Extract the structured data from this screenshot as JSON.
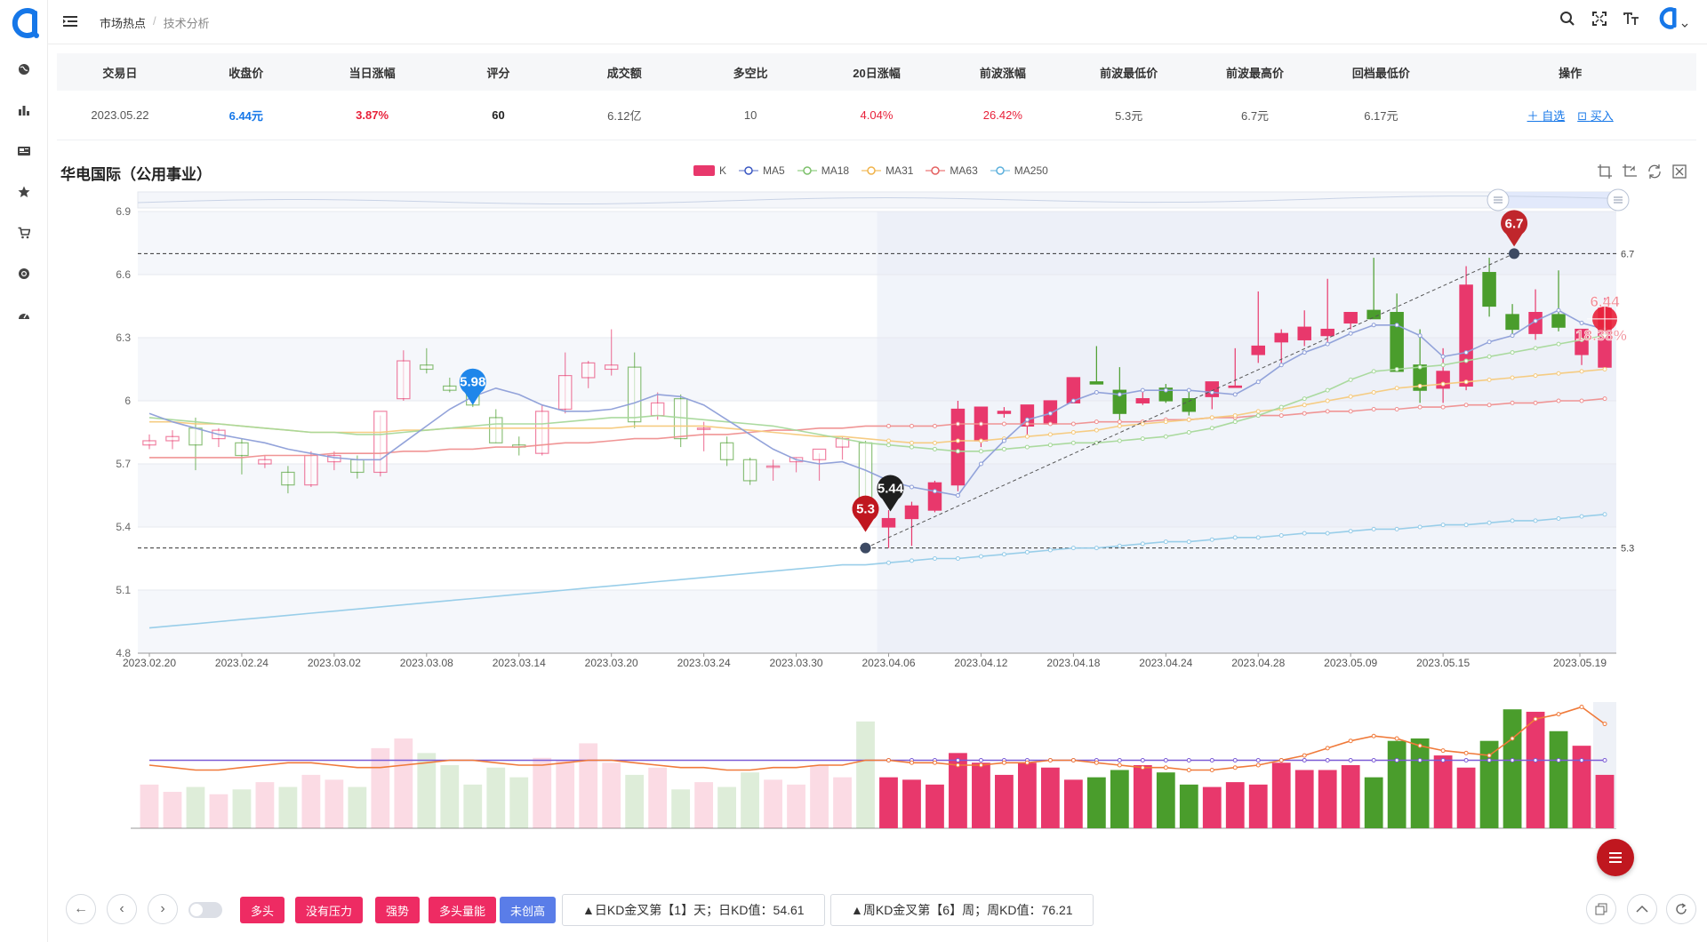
{
  "breadcrumb": {
    "root": "市场热点",
    "separator": "/",
    "current": "技术分析"
  },
  "summary": {
    "headers": [
      "交易日",
      "收盘价",
      "当日涨幅",
      "评分",
      "成交额",
      "多空比",
      "20日涨幅",
      "前波涨幅",
      "前波最低价",
      "前波最高价",
      "回档最低价",
      "操作"
    ],
    "row": {
      "date": "2023.05.22",
      "close": "6.44元",
      "change": "3.87%",
      "score": "60",
      "turnover": "6.12亿",
      "ratio": "10",
      "change20": "4.04%",
      "wave_change": "26.42%",
      "wave_low": "5.3元",
      "wave_high": "6.7元",
      "pullback_low": "6.17元",
      "op_watch": "自选",
      "op_buy": "买入"
    }
  },
  "chart_title": "华电国际（公用事业）",
  "legend": [
    "K",
    "MA5",
    "MA18",
    "MA31",
    "MA63",
    "MA250"
  ],
  "colors": {
    "up": "#e8386c",
    "down": "#4a9d2c",
    "ma5": "#8d9ed8",
    "ma18": "#a6d89a",
    "ma31": "#f5c97c",
    "ma63": "#ef8f8f",
    "ma250": "#94cbe8",
    "accent": "#1677e8"
  },
  "chart_data": {
    "type": "candlestick",
    "ylim": [
      4.8,
      6.9
    ],
    "yticks": [
      "6.9",
      "6.6",
      "6.3",
      "6",
      "5.7",
      "5.4",
      "5.1",
      "4.8"
    ],
    "xticks": [
      "2023.02.20",
      "2023.02.24",
      "2023.03.02",
      "2023.03.08",
      "2023.03.14",
      "2023.03.20",
      "2023.03.24",
      "2023.03.30",
      "2023.04.06",
      "2023.04.12",
      "2023.04.18",
      "2023.04.24",
      "2023.04.28",
      "2023.05.09",
      "2023.05.15",
      "2023.05.19"
    ],
    "candles": [
      {
        "o": 5.79,
        "h": 5.84,
        "l": 5.77,
        "c": 5.81
      },
      {
        "o": 5.81,
        "h": 5.86,
        "l": 5.77,
        "c": 5.83
      },
      {
        "o": 5.87,
        "h": 5.92,
        "l": 5.67,
        "c": 5.79
      },
      {
        "o": 5.82,
        "h": 5.87,
        "l": 5.78,
        "c": 5.86
      },
      {
        "o": 5.8,
        "h": 5.82,
        "l": 5.65,
        "c": 5.74
      },
      {
        "o": 5.7,
        "h": 5.74,
        "l": 5.68,
        "c": 5.72
      },
      {
        "o": 5.66,
        "h": 5.69,
        "l": 5.56,
        "c": 5.6
      },
      {
        "o": 5.6,
        "h": 5.76,
        "l": 5.59,
        "c": 5.74
      },
      {
        "o": 5.71,
        "h": 5.76,
        "l": 5.67,
        "c": 5.74
      },
      {
        "o": 5.72,
        "h": 5.74,
        "l": 5.63,
        "c": 5.66
      },
      {
        "o": 5.66,
        "h": 5.93,
        "l": 5.64,
        "c": 5.95
      },
      {
        "o": 6.01,
        "h": 6.24,
        "l": 6.0,
        "c": 6.19
      },
      {
        "o": 6.17,
        "h": 6.25,
        "l": 6.13,
        "c": 6.15
      },
      {
        "o": 6.07,
        "h": 6.11,
        "l": 6.04,
        "c": 6.05
      },
      {
        "o": 6.05,
        "h": 6.09,
        "l": 5.97,
        "c": 5.98
      },
      {
        "o": 5.92,
        "h": 5.96,
        "l": 5.8,
        "c": 5.8
      },
      {
        "o": 5.79,
        "h": 5.83,
        "l": 5.74,
        "c": 5.78
      },
      {
        "o": 5.75,
        "h": 5.98,
        "l": 5.74,
        "c": 5.95
      },
      {
        "o": 5.96,
        "h": 6.23,
        "l": 5.94,
        "c": 6.12
      },
      {
        "o": 6.11,
        "h": 6.19,
        "l": 6.06,
        "c": 6.18
      },
      {
        "o": 6.15,
        "h": 6.34,
        "l": 6.12,
        "c": 6.17
      },
      {
        "o": 6.16,
        "h": 6.23,
        "l": 5.87,
        "c": 5.9
      },
      {
        "o": 5.93,
        "h": 6.04,
        "l": 5.91,
        "c": 5.99
      },
      {
        "o": 6.01,
        "h": 6.03,
        "l": 5.78,
        "c": 5.82
      },
      {
        "o": 5.87,
        "h": 5.9,
        "l": 5.76,
        "c": 5.87
      },
      {
        "o": 5.8,
        "h": 5.83,
        "l": 5.69,
        "c": 5.72
      },
      {
        "o": 5.72,
        "h": 5.73,
        "l": 5.6,
        "c": 5.62
      },
      {
        "o": 5.69,
        "h": 5.72,
        "l": 5.62,
        "c": 5.69
      },
      {
        "o": 5.71,
        "h": 5.73,
        "l": 5.66,
        "c": 5.73
      },
      {
        "o": 5.72,
        "h": 5.75,
        "l": 5.62,
        "c": 5.77
      },
      {
        "o": 5.78,
        "h": 5.83,
        "l": 5.72,
        "c": 5.82
      },
      {
        "o": 5.8,
        "h": 5.81,
        "l": 5.42,
        "c": 5.44
      },
      {
        "o": 5.4,
        "h": 5.48,
        "l": 5.3,
        "c": 5.44
      },
      {
        "o": 5.44,
        "h": 5.52,
        "l": 5.31,
        "c": 5.5
      },
      {
        "o": 5.48,
        "h": 5.62,
        "l": 5.47,
        "c": 5.61
      },
      {
        "o": 5.6,
        "h": 6.0,
        "l": 5.57,
        "c": 5.96
      },
      {
        "o": 5.81,
        "h": 5.97,
        "l": 5.78,
        "c": 5.97
      },
      {
        "o": 5.94,
        "h": 5.97,
        "l": 5.92,
        "c": 5.95
      },
      {
        "o": 5.88,
        "h": 5.98,
        "l": 5.84,
        "c": 5.98
      },
      {
        "o": 5.89,
        "h": 6.0,
        "l": 5.89,
        "c": 6.0
      },
      {
        "o": 5.99,
        "h": 6.11,
        "l": 5.99,
        "c": 6.11
      },
      {
        "o": 6.09,
        "h": 6.26,
        "l": 6.08,
        "c": 6.08
      },
      {
        "o": 6.05,
        "h": 6.16,
        "l": 5.9,
        "c": 5.94
      },
      {
        "o": 5.99,
        "h": 6.04,
        "l": 5.98,
        "c": 6.01
      },
      {
        "o": 6.06,
        "h": 6.08,
        "l": 5.99,
        "c": 6.0
      },
      {
        "o": 6.01,
        "h": 6.05,
        "l": 5.93,
        "c": 5.95
      },
      {
        "o": 6.02,
        "h": 6.08,
        "l": 5.96,
        "c": 6.09
      },
      {
        "o": 6.07,
        "h": 6.25,
        "l": 6.07,
        "c": 6.07
      },
      {
        "o": 6.22,
        "h": 6.52,
        "l": 6.18,
        "c": 6.26
      },
      {
        "o": 6.28,
        "h": 6.34,
        "l": 6.17,
        "c": 6.32
      },
      {
        "o": 6.29,
        "h": 6.43,
        "l": 6.26,
        "c": 6.35
      },
      {
        "o": 6.31,
        "h": 6.58,
        "l": 6.28,
        "c": 6.34
      },
      {
        "o": 6.37,
        "h": 6.41,
        "l": 6.34,
        "c": 6.42
      },
      {
        "o": 6.43,
        "h": 6.68,
        "l": 6.41,
        "c": 6.39
      },
      {
        "o": 6.42,
        "h": 6.51,
        "l": 6.18,
        "c": 6.14
      },
      {
        "o": 6.17,
        "h": 6.34,
        "l": 5.99,
        "c": 6.05
      },
      {
        "o": 6.06,
        "h": 6.25,
        "l": 5.99,
        "c": 6.14
      },
      {
        "o": 6.07,
        "h": 6.64,
        "l": 6.05,
        "c": 6.55
      },
      {
        "o": 6.61,
        "h": 6.68,
        "l": 6.4,
        "c": 6.45
      },
      {
        "o": 6.41,
        "h": 6.46,
        "l": 6.3,
        "c": 6.34
      },
      {
        "o": 6.32,
        "h": 6.53,
        "l": 6.29,
        "c": 6.42
      },
      {
        "o": 6.41,
        "h": 6.62,
        "l": 6.33,
        "c": 6.35
      },
      {
        "o": 6.22,
        "h": 6.33,
        "l": 6.17,
        "c": 6.34
      },
      {
        "o": 6.16,
        "h": 6.49,
        "l": 6.15,
        "c": 6.44
      }
    ],
    "ma5": [
      5.94,
      5.9,
      5.87,
      5.84,
      5.82,
      5.8,
      5.77,
      5.75,
      5.73,
      5.72,
      5.72,
      5.8,
      5.88,
      5.96,
      6.02,
      6.06,
      6.03,
      5.98,
      5.95,
      5.95,
      5.96,
      5.99,
      6.03,
      6.02,
      5.98,
      5.91,
      5.84,
      5.77,
      5.72,
      5.7,
      5.71,
      5.67,
      5.62,
      5.59,
      5.57,
      5.55,
      5.7,
      5.81,
      5.91,
      5.94,
      6.0,
      6.04,
      6.03,
      6.05,
      6.05,
      6.05,
      6.04,
      6.03,
      6.09,
      6.17,
      6.23,
      6.27,
      6.32,
      6.36,
      6.36,
      6.31,
      6.21,
      6.23,
      6.28,
      6.31,
      6.38,
      6.43,
      6.37,
      6.34
    ],
    "ma18": [
      5.92,
      5.91,
      5.9,
      5.89,
      5.88,
      5.87,
      5.86,
      5.85,
      5.85,
      5.84,
      5.84,
      5.85,
      5.86,
      5.87,
      5.88,
      5.89,
      5.89,
      5.89,
      5.9,
      5.91,
      5.92,
      5.92,
      5.93,
      5.92,
      5.91,
      5.9,
      5.89,
      5.88,
      5.86,
      5.84,
      5.82,
      5.8,
      5.79,
      5.78,
      5.77,
      5.76,
      5.76,
      5.77,
      5.78,
      5.79,
      5.8,
      5.8,
      5.81,
      5.82,
      5.83,
      5.85,
      5.87,
      5.9,
      5.93,
      5.97,
      6.01,
      6.05,
      6.1,
      6.14,
      6.15,
      6.16,
      6.17,
      6.19,
      6.21,
      6.23,
      6.25,
      6.27,
      6.29,
      6.31
    ],
    "ma31": [
      5.9,
      5.9,
      5.89,
      5.89,
      5.88,
      5.87,
      5.86,
      5.85,
      5.85,
      5.85,
      5.85,
      5.86,
      5.86,
      5.87,
      5.87,
      5.87,
      5.87,
      5.87,
      5.87,
      5.87,
      5.87,
      5.88,
      5.88,
      5.88,
      5.88,
      5.87,
      5.86,
      5.85,
      5.84,
      5.83,
      5.83,
      5.82,
      5.81,
      5.8,
      5.8,
      5.81,
      5.81,
      5.82,
      5.83,
      5.84,
      5.85,
      5.86,
      5.88,
      5.89,
      5.9,
      5.91,
      5.92,
      5.93,
      5.95,
      5.96,
      5.98,
      6.0,
      6.02,
      6.04,
      6.06,
      6.07,
      6.08,
      6.09,
      6.1,
      6.11,
      6.12,
      6.13,
      6.14,
      6.15
    ],
    "ma63": [
      5.73,
      5.73,
      5.73,
      5.73,
      5.73,
      5.74,
      5.74,
      5.74,
      5.75,
      5.75,
      5.75,
      5.76,
      5.76,
      5.77,
      5.77,
      5.78,
      5.78,
      5.79,
      5.8,
      5.8,
      5.81,
      5.82,
      5.82,
      5.83,
      5.84,
      5.84,
      5.85,
      5.86,
      5.86,
      5.87,
      5.87,
      5.88,
      5.88,
      5.88,
      5.88,
      5.89,
      5.89,
      5.89,
      5.89,
      5.89,
      5.89,
      5.9,
      5.9,
      5.9,
      5.91,
      5.91,
      5.92,
      5.92,
      5.93,
      5.93,
      5.94,
      5.95,
      5.95,
      5.96,
      5.96,
      5.97,
      5.97,
      5.98,
      5.98,
      5.99,
      5.99,
      6.0,
      6.0,
      6.01
    ],
    "ma250": [
      4.92,
      4.93,
      4.94,
      4.95,
      4.96,
      4.97,
      4.98,
      4.99,
      5.0,
      5.01,
      5.02,
      5.03,
      5.04,
      5.05,
      5.06,
      5.07,
      5.08,
      5.09,
      5.1,
      5.11,
      5.12,
      5.13,
      5.14,
      5.15,
      5.16,
      5.17,
      5.18,
      5.19,
      5.2,
      5.21,
      5.22,
      5.22,
      5.23,
      5.24,
      5.25,
      5.25,
      5.26,
      5.27,
      5.28,
      5.29,
      5.3,
      5.3,
      5.31,
      5.32,
      5.33,
      5.33,
      5.34,
      5.35,
      5.35,
      5.36,
      5.37,
      5.37,
      5.38,
      5.39,
      5.39,
      5.4,
      5.41,
      5.41,
      5.42,
      5.43,
      5.43,
      5.44,
      5.45,
      5.46
    ],
    "volume": [
      18,
      15,
      17,
      14,
      16,
      19,
      17,
      22,
      20,
      17,
      33,
      37,
      31,
      26,
      18,
      25,
      21,
      29,
      28,
      35,
      27,
      22,
      25,
      16,
      19,
      17,
      23,
      20,
      18,
      26,
      21,
      44,
      21,
      20,
      18,
      31,
      27,
      22,
      27,
      25,
      20,
      21,
      24,
      26,
      23,
      18,
      17,
      19,
      18,
      27,
      24,
      24,
      26,
      21,
      36,
      37,
      30,
      25,
      36,
      49,
      48,
      40,
      34,
      22,
      29
    ],
    "vol_line_a": [
      26,
      25,
      24,
      24,
      25,
      26,
      27,
      27,
      26,
      25,
      25,
      26,
      27,
      28,
      28,
      27,
      26,
      26,
      27,
      28,
      28,
      27,
      26,
      25,
      25,
      24,
      24,
      25,
      25,
      26,
      26,
      28,
      28,
      27,
      27,
      26,
      26,
      27,
      27,
      28,
      28,
      27,
      26,
      25,
      25,
      24,
      24,
      25,
      26,
      28,
      30,
      33,
      36,
      38,
      37,
      34,
      32,
      31,
      30,
      37,
      45,
      47,
      50,
      43,
      37
    ],
    "vol_line_b": [
      28,
      28,
      28,
      28,
      28,
      28,
      28,
      28,
      28,
      28,
      28,
      28,
      28,
      28,
      28,
      28,
      28,
      28,
      28,
      28,
      28,
      28,
      28,
      28,
      28,
      28,
      28,
      28,
      28,
      28,
      28,
      28,
      28,
      28,
      28,
      28,
      28,
      28,
      28,
      28,
      28,
      28,
      28,
      28,
      28,
      28,
      28,
      28,
      28,
      28,
      28,
      28,
      28,
      28,
      28,
      28,
      28,
      28,
      28,
      28,
      28,
      28,
      28,
      28,
      28
    ],
    "markers": {
      "high": {
        "label": "6.7",
        "value": 6.7
      },
      "low": {
        "label": "5.3",
        "value": 5.3
      },
      "blue": {
        "label": "5.98"
      },
      "black": {
        "label": "5.44"
      },
      "current": {
        "label": "6.44",
        "pct": "18.38%"
      }
    },
    "ref_lines": [
      "6.7",
      "5.3"
    ]
  },
  "bottom": {
    "tags": [
      "多头",
      "没有压力",
      "强势",
      "多头量能",
      "未创高"
    ],
    "kd_day": "▲日KD金叉第【1】天；日KD值：54.61",
    "kd_week": "▲周KD金叉第【6】周；周KD值：76.21"
  }
}
